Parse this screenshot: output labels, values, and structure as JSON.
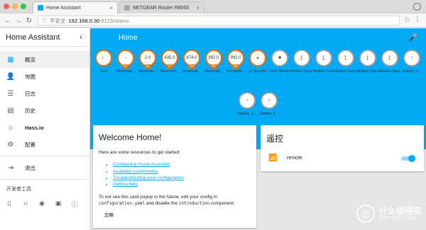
{
  "browser": {
    "tabs": [
      {
        "title": "Home Assistant",
        "icon_color": "#03a9f4",
        "active": true
      },
      {
        "title": "NETGEAR Router R8500",
        "icon_color": "#aaaaaa",
        "active": false
      }
    ],
    "close_glyph": "×",
    "url_security": "不安全",
    "url_host": "192.168.0.30",
    "url_path": ":8123/states"
  },
  "sidebar": {
    "title": "Home Assistant",
    "items": [
      {
        "label": "概览",
        "icon": "grid-icon",
        "glyph": "▦"
      },
      {
        "label": "地图",
        "icon": "person-icon",
        "glyph": "👤"
      },
      {
        "label": "日志",
        "icon": "list-icon",
        "glyph": "☰"
      },
      {
        "label": "历史",
        "icon": "chart-icon",
        "glyph": "▤"
      },
      {
        "label": "Hass.io",
        "icon": "home-icon",
        "glyph": "⌂"
      },
      {
        "label": "配置",
        "icon": "gear-icon",
        "glyph": "⚙"
      }
    ],
    "logout_label": "退出",
    "dev_tools_title": "开发者工具",
    "dev_tools": [
      {
        "name": "remote-dev-icon",
        "glyph": "▯"
      },
      {
        "name": "code-dev-icon",
        "glyph": "‹›"
      },
      {
        "name": "broadcast-dev-icon",
        "glyph": "◉"
      },
      {
        "name": "file-dev-icon",
        "glyph": "▣"
      },
      {
        "name": "info-dev-icon",
        "glyph": "ⓘ"
      }
    ]
  },
  "toolbar": {
    "title": "Home"
  },
  "badges": [
    {
      "value": "☾",
      "unit": "",
      "label": "Sun",
      "style": "orange"
    },
    {
      "value": "-",
      "unit": "lx",
      "label": "Illuminati...",
      "style": "orange"
    },
    {
      "value": "2.0",
      "unit": "lx",
      "label": "Illuminati...",
      "style": "orange"
    },
    {
      "value": "435.0",
      "unit": "lx",
      "label": "Illuminati...",
      "style": "orange"
    },
    {
      "value": "874.0",
      "unit": "lm",
      "label": "Illuminati...",
      "style": "orange"
    },
    {
      "value": "992.0",
      "unit": "lm",
      "label": "Illuminati...",
      "style": "orange"
    },
    {
      "value": "992.0",
      "unit": "lm",
      "label": "Illuminati...",
      "style": "orange"
    },
    {
      "value": "☀",
      "unit": "",
      "label": "yr Symbol",
      "style": "orange"
    },
    {
      "value": "■",
      "unit": "",
      "label": "Door Window Sensor_1...",
      "style": "blue"
    },
    {
      "value": "🚶",
      "unit": "",
      "label": "Motion Sensor_1...",
      "style": "blue"
    },
    {
      "value": "🚶",
      "unit": "",
      "label": "Motion Sensor_1...",
      "style": "blue"
    },
    {
      "value": "🚶",
      "unit": "",
      "label": "Motion Sensor_1...",
      "style": "blue"
    },
    {
      "value": "🚶",
      "unit": "",
      "label": "Motion Sensor_1...",
      "style": "blue"
    },
    {
      "value": "🚶",
      "unit": "",
      "label": "Motion Sensor_1...",
      "style": "blue"
    },
    {
      "value": "○",
      "unit": "",
      "label": "Switch_1...",
      "style": "blue"
    },
    {
      "value": "○",
      "unit": "",
      "label": "Switch_1...",
      "style": "blue"
    },
    {
      "value": "○",
      "unit": "",
      "label": "Switch_1...",
      "style": "blue"
    }
  ],
  "welcome": {
    "title": "Welcome Home!",
    "intro": "Here are some resources to get started:",
    "links": [
      "Configuring Home Assistant",
      "Available components",
      "Troubleshooting your configuration",
      "Getting help"
    ],
    "note_1": "To not see this card popup in the future, edit your config in",
    "note_code_1": "configuration.yaml",
    "note_2": " and disable the ",
    "note_code_2": "introduction",
    "note_3": " component.",
    "dismiss_label": "忽略"
  },
  "remote_card": {
    "title": "遥控",
    "entity_label": "remote",
    "toggle_on": true
  },
  "watermark": {
    "logo_text": "值",
    "text": "什么值得买",
    "sub": "SMZDM.COM"
  },
  "colors": {
    "primary": "#03a9f4",
    "badge_orange": "#ef6c00"
  }
}
